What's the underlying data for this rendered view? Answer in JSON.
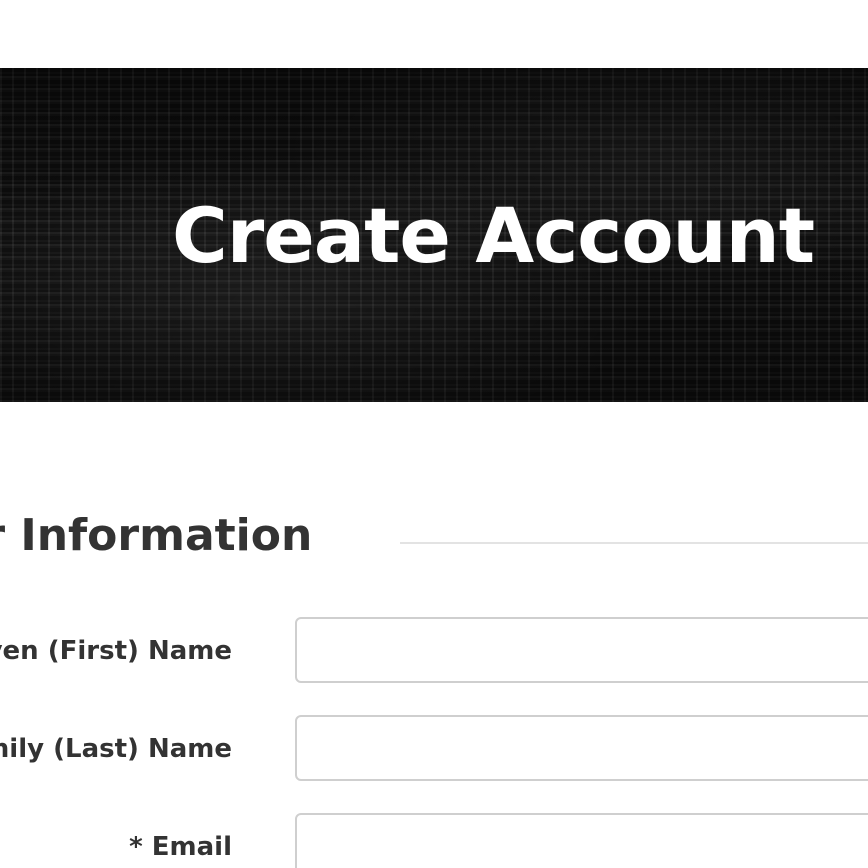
{
  "hero": {
    "title": "Create Account"
  },
  "section": {
    "heading": "ur Information"
  },
  "form": {
    "fields": [
      {
        "label": "iven (First) Name",
        "value": ""
      },
      {
        "label": "mily (Last) Name",
        "value": ""
      },
      {
        "label": "* Email",
        "value": ""
      }
    ]
  },
  "colors": {
    "hero_background": "#1a1a1a",
    "hero_text": "#ffffff",
    "label_text": "#333333",
    "input_border": "#cfcfcf",
    "divider": "#e3e3e3"
  }
}
